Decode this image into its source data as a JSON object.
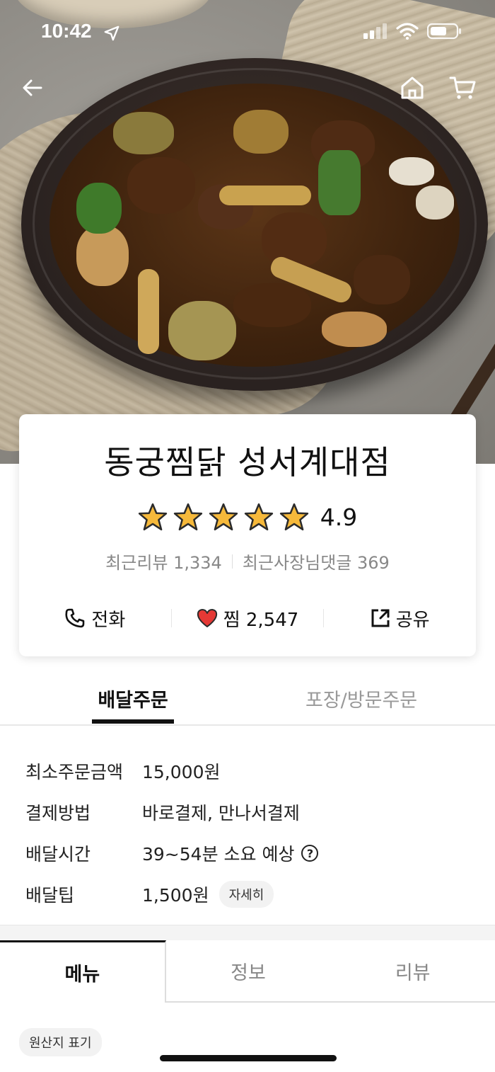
{
  "status": {
    "time": "10:42"
  },
  "header": {
    "back_icon": "back-arrow-icon",
    "home_icon": "home-icon",
    "cart_icon": "cart-icon"
  },
  "store": {
    "name": "동궁찜닭 성서계대점",
    "rating": 4.9,
    "rating_text": "4.9",
    "stars": 5,
    "recent_reviews_label": "최근리뷰 1,334",
    "recent_owner_replies_label": "최근사장님댓글 369",
    "star_color": "#F6B93B"
  },
  "actions": {
    "call": "전화",
    "favorite": "찜 2,547",
    "share": "공유",
    "heart_color": "#E53935"
  },
  "order_tabs": {
    "delivery": "배달주문",
    "pickup": "포장/방문주문"
  },
  "info": [
    {
      "label": "최소주문금액",
      "value": "15,000원"
    },
    {
      "label": "결제방법",
      "value": "바로결제, 만나서결제"
    },
    {
      "label": "배달시간",
      "value": "39~54분 소요 예상"
    },
    {
      "label": "배달팁",
      "value": "1,500원",
      "chip": "자세히"
    }
  ],
  "help_glyph": "?",
  "menu_tabs": {
    "menu": "메뉴",
    "info": "정보",
    "review": "리뷰"
  },
  "origin_label": "원산지 표기"
}
